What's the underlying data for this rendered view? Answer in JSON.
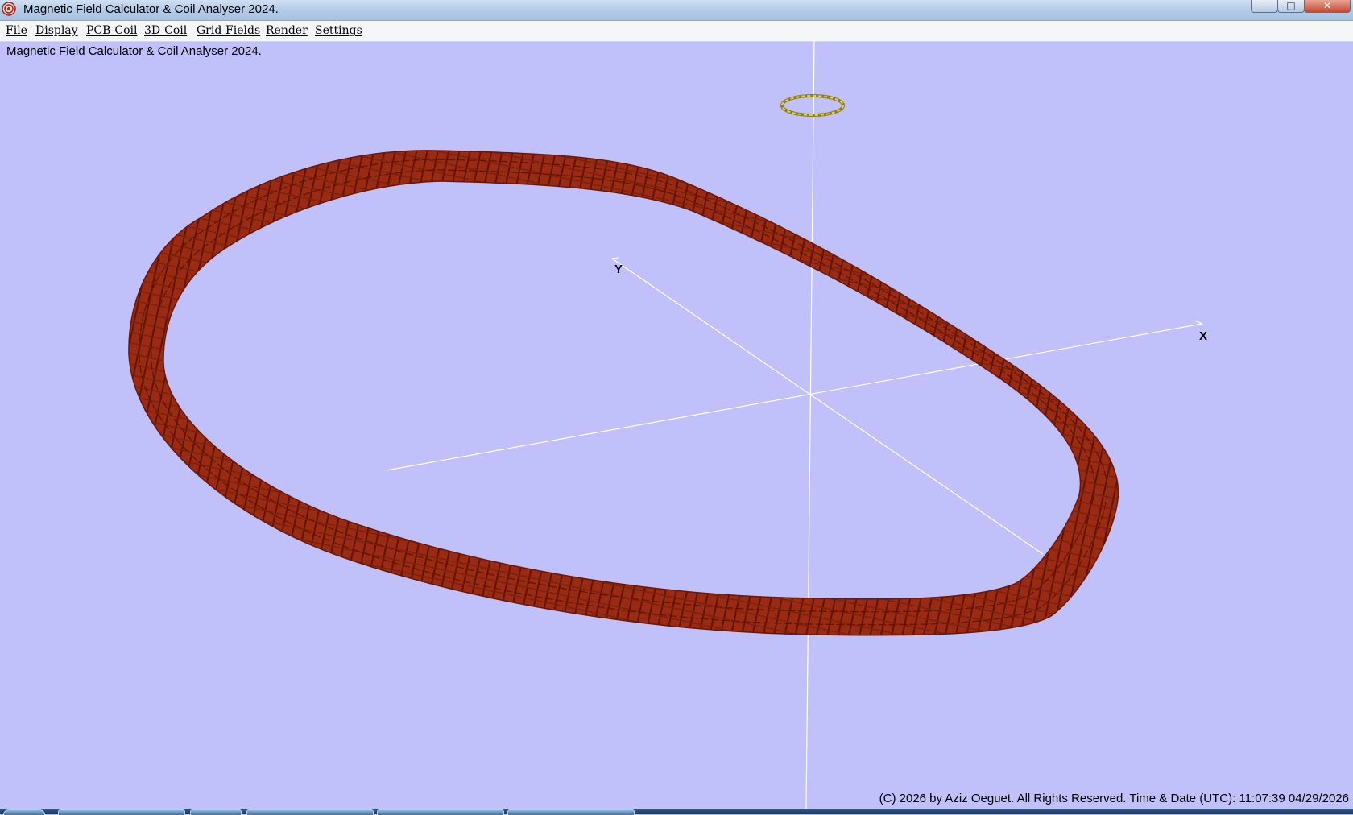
{
  "window": {
    "title": "Magnetic Field Calculator & Coil Analyser 2024.",
    "controls": {
      "minimize": "—",
      "maximize": "□",
      "close": "✕"
    }
  },
  "menu": [
    "File",
    "Display",
    "PCB-Coil",
    "3D-Coil",
    "Grid-Fields",
    "Render",
    "Settings"
  ],
  "status_text": "Magnetic Field Calculator & Coil Analyser 2024.",
  "axes": {
    "x_label": "X",
    "y_label": "Y"
  },
  "footer": "(C) 2026  by Aziz Oeguet. All Rights Reserved.  Time & Date (UTC): 11:07:39  04/29/2026",
  "colors": {
    "background": "#c0c0fb",
    "coil": "#9a2a12",
    "coil_dark": "#5e1405",
    "axis": "#ffffff",
    "marker": "#d8c23a"
  },
  "icons": {
    "app": "coil-app-icon"
  }
}
